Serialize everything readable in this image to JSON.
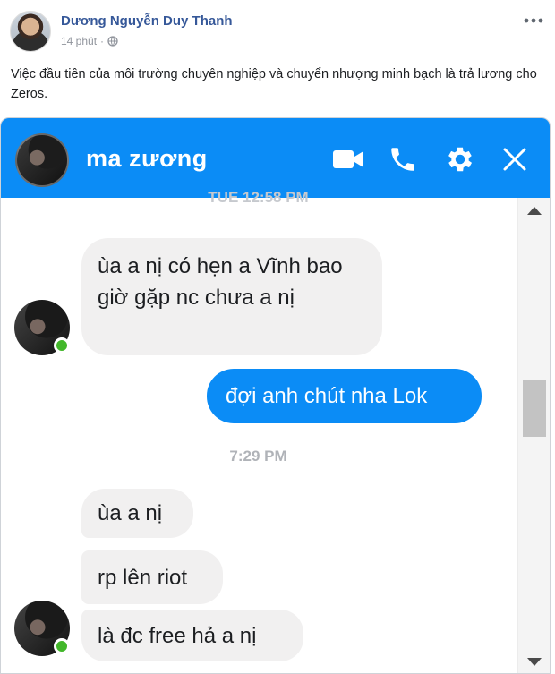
{
  "post": {
    "author": "Dương Nguyễn Duy Thanh",
    "time": "14 phút",
    "separator": "·",
    "text": "Việc đầu tiên của môi trường chuyên nghiệp và chuyển nhượng minh bạch là trả lương cho Zeros.",
    "icons": {
      "privacy": "globe-icon",
      "options": "more-options-icon"
    }
  },
  "chat": {
    "contact_name": "ma zương",
    "header_icons": [
      "video-call-icon",
      "voice-call-icon",
      "settings-gear-icon",
      "close-icon"
    ],
    "header_color": "#0b8cf6",
    "timestamps": {
      "top": "TUE 12:58 PM",
      "middle": "7:29 PM"
    },
    "messages": [
      {
        "from": "contact",
        "text": "ùa a nị có hẹn a Vĩnh bao giờ gặp nc chưa a nị"
      },
      {
        "from": "me",
        "text": "đợi anh chút nha Lok"
      },
      {
        "from": "contact",
        "text": "ùa a nị"
      },
      {
        "from": "contact",
        "text": "rp lên riot"
      },
      {
        "from": "contact",
        "text": "là đc free hả a nị"
      }
    ],
    "online_status_color": "#42b72a"
  }
}
